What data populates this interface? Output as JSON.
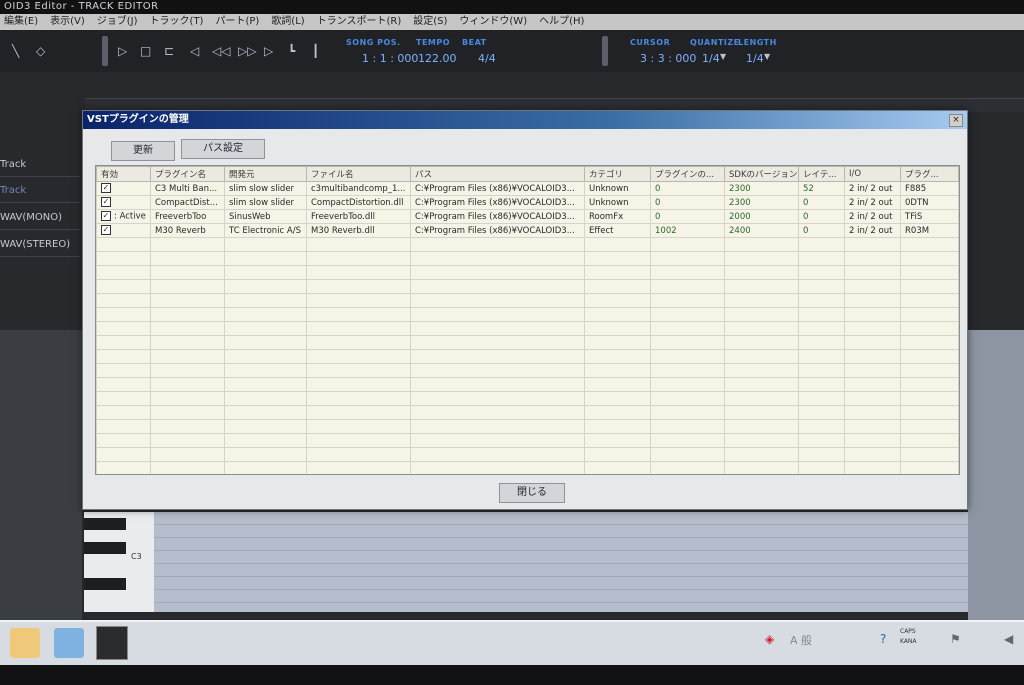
{
  "app": {
    "title": "OID3 Editor - TRACK EDITOR"
  },
  "menu": [
    "編集(E)",
    "表示(V)",
    "ジョブ(J)",
    "トラック(T)",
    "パート(P)",
    "歌詞(L)",
    "トランスポート(R)",
    "設定(S)",
    "ウィンドウ(W)",
    "ヘルプ(H)"
  ],
  "transport": {
    "song_pos_label": "SONG POS.",
    "song_pos": "1 : 1 : 000",
    "tempo_label": "TEMPO",
    "tempo": "122.00",
    "beat_label": "BEAT",
    "beat": "4/4",
    "cursor_label": "CURSOR",
    "cursor": "3 : 3 : 000",
    "quantize_label": "QUANTIZE",
    "quantize": "1/4",
    "length_label": "LENGTH",
    "length": "1/4"
  },
  "tracks": [
    "Track",
    "Track",
    "WAV(MONO)",
    "WAV(STEREO)"
  ],
  "pianoroll": {
    "key_label": "C3"
  },
  "dialog": {
    "title": "VSTプラグインの管理",
    "close_glyph": "×",
    "refresh_label": "更新",
    "path_settings_label": "パス設定",
    "close_label": "閉じる",
    "columns": [
      "有効",
      "プラグイン名",
      "開発元",
      "ファイル名",
      "パス",
      "カテゴリ",
      "プラグインの...",
      "SDKのバージョン",
      "レイテ...",
      "I/O",
      "プラグ..."
    ],
    "rows": [
      {
        "enabled": "",
        "name": "C3 Multi Ban...",
        "vendor": "slim slow slider",
        "file": "c3multibandcomp_1...",
        "path": "C:¥Program Files (x86)¥VOCALOID3...",
        "category": "Unknown",
        "plugin_ver": "0",
        "sdk": "2300",
        "latency": "52",
        "io": "2 in/ 2 out",
        "id": "F885"
      },
      {
        "enabled": "",
        "name": "CompactDist...",
        "vendor": "slim slow slider",
        "file": "CompactDistortion.dll",
        "path": "C:¥Program Files (x86)¥VOCALOID3...",
        "category": "Unknown",
        "plugin_ver": "0",
        "sdk": "2300",
        "latency": "0",
        "io": "2 in/ 2 out",
        "id": "0DTN"
      },
      {
        "enabled": ": Active",
        "name": "FreeverbToo",
        "vendor": "SinusWeb",
        "file": "FreeverbToo.dll",
        "path": "C:¥Program Files (x86)¥VOCALOID3...",
        "category": "RoomFx",
        "plugin_ver": "0",
        "sdk": "2000",
        "latency": "0",
        "io": "2 in/ 2 out",
        "id": "TFiS"
      },
      {
        "enabled": "",
        "name": "M30 Reverb",
        "vendor": "TC Electronic A/S",
        "file": "M30 Reverb.dll",
        "path": "C:¥Program Files (x86)¥VOCALOID3...",
        "category": "Effect",
        "plugin_ver": "1002",
        "sdk": "2400",
        "latency": "0",
        "io": "2 in/ 2 out",
        "id": "R03M"
      }
    ],
    "checkbox_glyph": "✓"
  },
  "taskbar": {
    "ime_text": "A 般",
    "caps": "CAPS",
    "kana": "KANA"
  }
}
